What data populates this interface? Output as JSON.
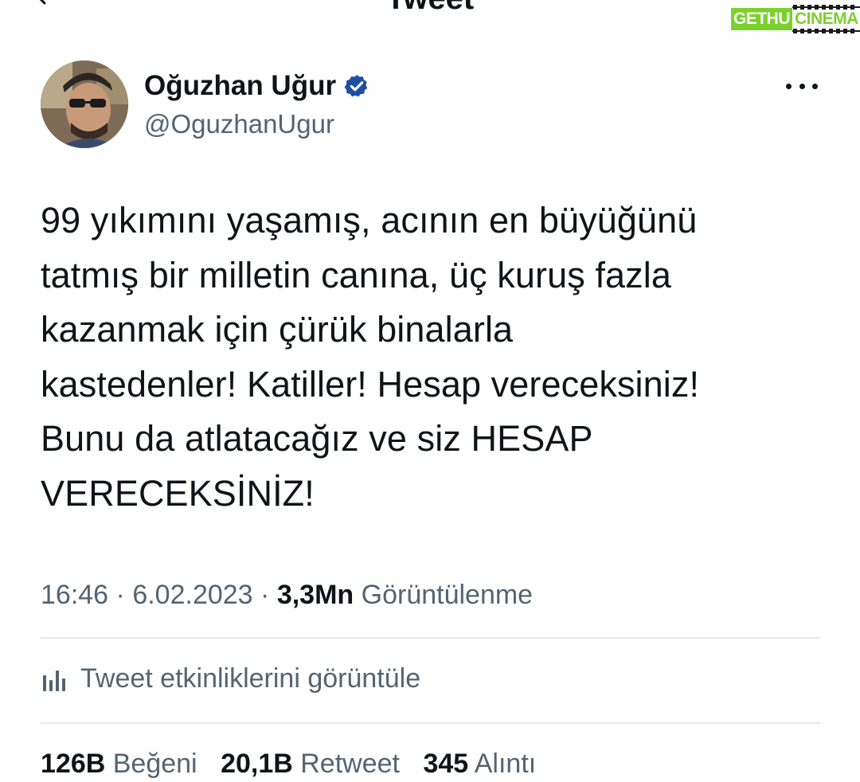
{
  "header": {
    "title": "Tweet",
    "back_icon": "back-arrow-icon"
  },
  "watermark": {
    "left": "GETHU",
    "right": "CINEMA",
    "accent_color": "#7ad12c"
  },
  "tweet": {
    "author": {
      "display_name": "Oğuzhan Uğur",
      "handle": "@OguzhanUgur",
      "verified": true,
      "verified_color": "#1d9bf0"
    },
    "more_icon": "more-horizontal-icon",
    "text": "99 yıkımını yaşamış, acının en büyüğünü\ntatmış bir milletin canına, üç kuruş fazla\nkazanmak için çürük binalarla\nkastedenler! Katiller! Hesap vereceksiniz!\nBunu da atlatacağız ve siz HESAP\nVERECEKSİNİZ!",
    "meta": {
      "time": "16:46",
      "separator": "·",
      "date": "6.02.2023",
      "views_count": "3,3Mn",
      "views_label": "Görüntülenme"
    },
    "activity_label": "Tweet etkinliklerini görüntüle",
    "stats": {
      "likes_count": "126B",
      "likes_label": "Beğeni",
      "retweets_count": "20,1B",
      "retweets_label": "Retweet",
      "quotes_count": "345",
      "quotes_label": "Alıntı"
    }
  }
}
